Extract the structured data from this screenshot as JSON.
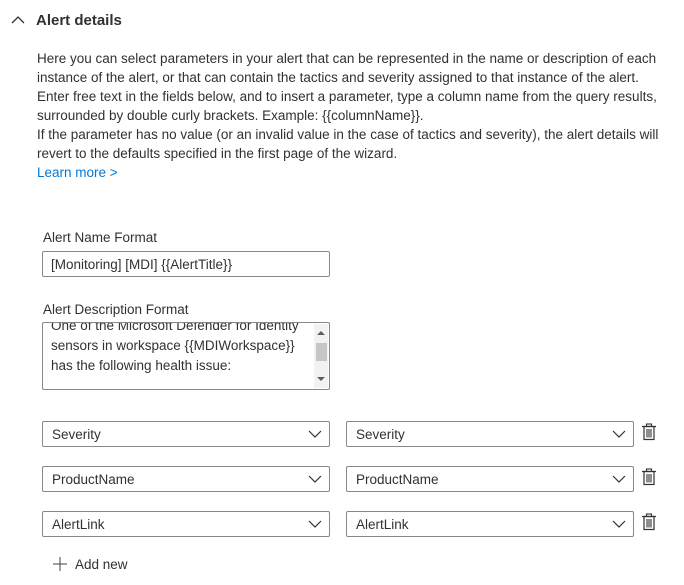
{
  "section": {
    "title": "Alert details",
    "expand_icon": "chevron-up-icon"
  },
  "description": {
    "paragraph1": "Here you can select parameters in your alert that can be represented in the name or description of each instance of the alert, or that can contain the tactics and severity assigned to that instance of the alert.",
    "paragraph2": "Enter free text in the fields below, and to insert a parameter, type a column name from the query results, surrounded by double curly brackets. Example: {{columnName}}.",
    "paragraph3": "If the parameter has no value (or an invalid value in the case of tactics and severity), the alert details will revert to the defaults specified in the first page of the wizard.",
    "learn_more": "Learn more >"
  },
  "alert_name": {
    "label": "Alert Name Format",
    "value": "[Monitoring] [MDI] {{AlertTitle}}"
  },
  "alert_description": {
    "label": "Alert Description Format",
    "value": "One of the Microsoft Defender for Identity sensors in workspace {{MDIWorkspace}} has the following health issue:"
  },
  "mappings": [
    {
      "left": "Severity",
      "right": "Severity"
    },
    {
      "left": "ProductName",
      "right": "ProductName"
    },
    {
      "left": "AlertLink",
      "right": "AlertLink"
    }
  ],
  "add_new": "Add new",
  "colors": {
    "link": "#0078d4",
    "border": "#8a8886",
    "text": "#323130"
  }
}
